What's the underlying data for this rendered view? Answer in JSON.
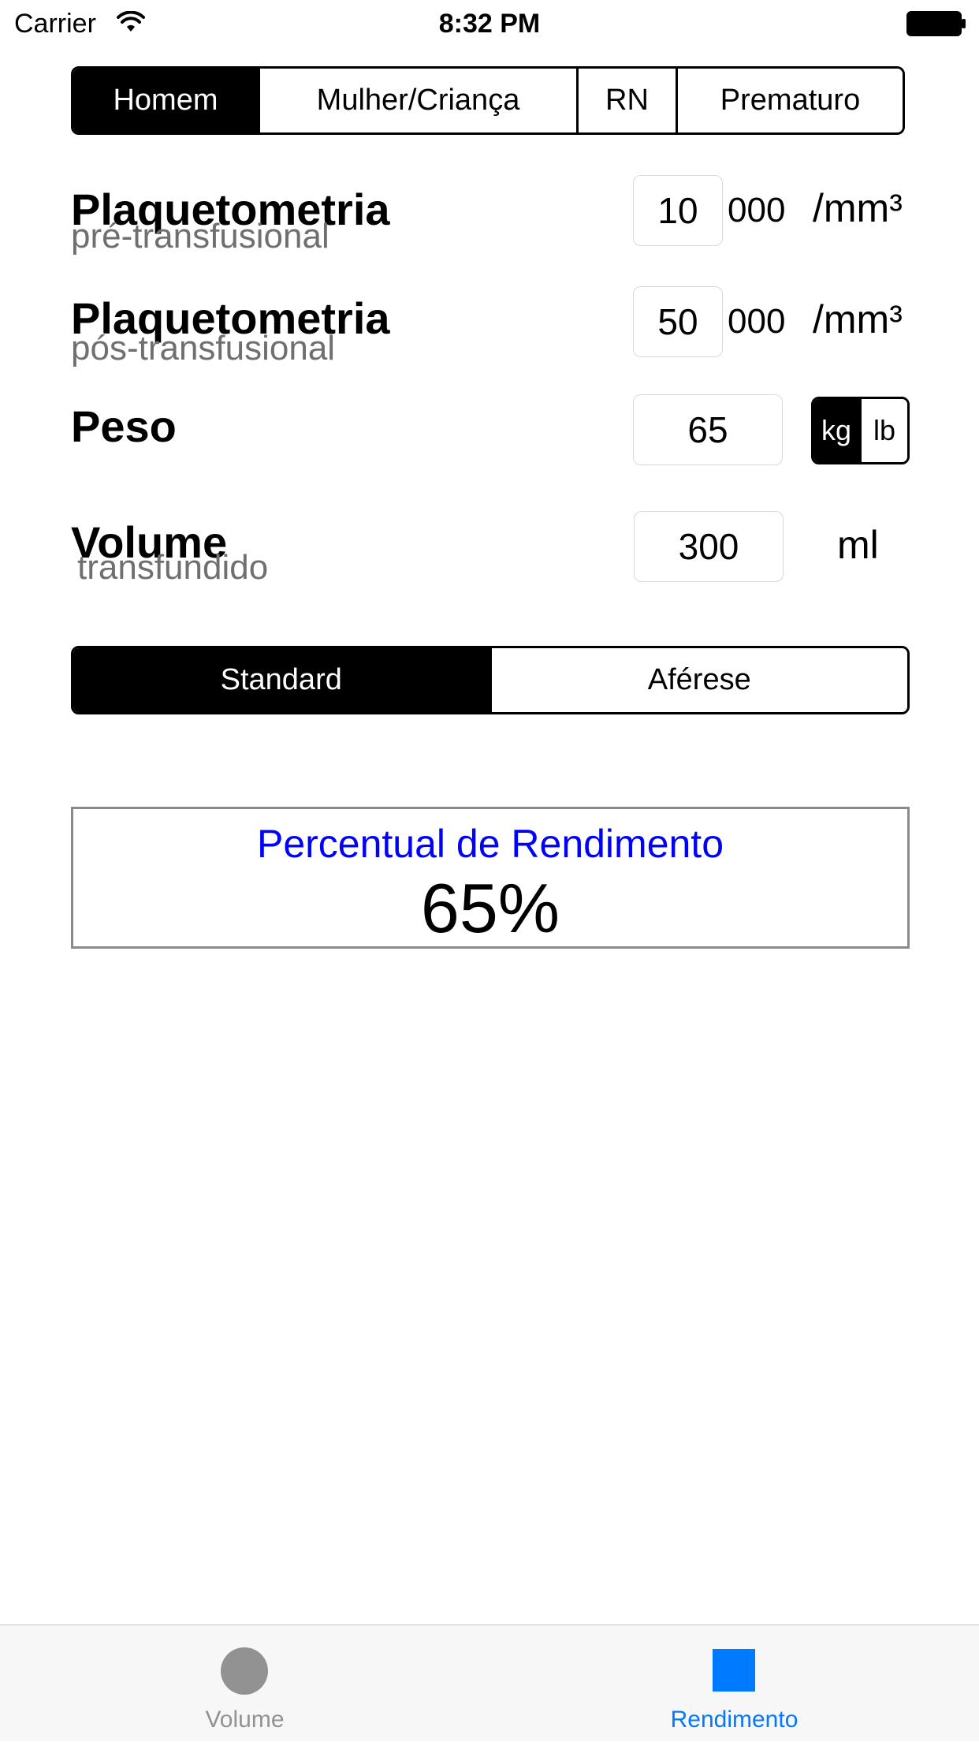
{
  "status_bar": {
    "carrier": "Carrier",
    "time": "8:32 PM",
    "icons": [
      "wifi-icon",
      "battery-icon"
    ]
  },
  "patient_type": {
    "options": [
      "Homem",
      "Mulher/Criança",
      "RN",
      "Prematuro"
    ],
    "selected": "Homem"
  },
  "fields": {
    "pre": {
      "label": "Plaquetometria",
      "sublabel": "pré-transfusional",
      "value": "10",
      "suffix": "000",
      "unit": "/mm³"
    },
    "post": {
      "label": "Plaquetometria",
      "sublabel": "pós-transfusional",
      "value": "50",
      "suffix": "000",
      "unit": "/mm³"
    },
    "weight": {
      "label": "Peso",
      "value": "65",
      "units": [
        "kg",
        "lb"
      ],
      "selected_unit": "kg"
    },
    "volume": {
      "label": "Volume",
      "sublabel": "transfundido",
      "value": "300",
      "unit": "ml"
    }
  },
  "product_type": {
    "options": [
      "Standard",
      "Aférese"
    ],
    "selected": "Standard"
  },
  "result": {
    "title": "Percentual de Rendimento",
    "value": "65%",
    "title_color": "#0000ff"
  },
  "tab_bar": {
    "tabs": [
      {
        "label": "Volume",
        "icon": "circle-icon",
        "active": false
      },
      {
        "label": "Rendimento",
        "icon": "square-icon",
        "active": true
      }
    ],
    "active_color": "#007aff",
    "inactive_color": "#929292"
  }
}
